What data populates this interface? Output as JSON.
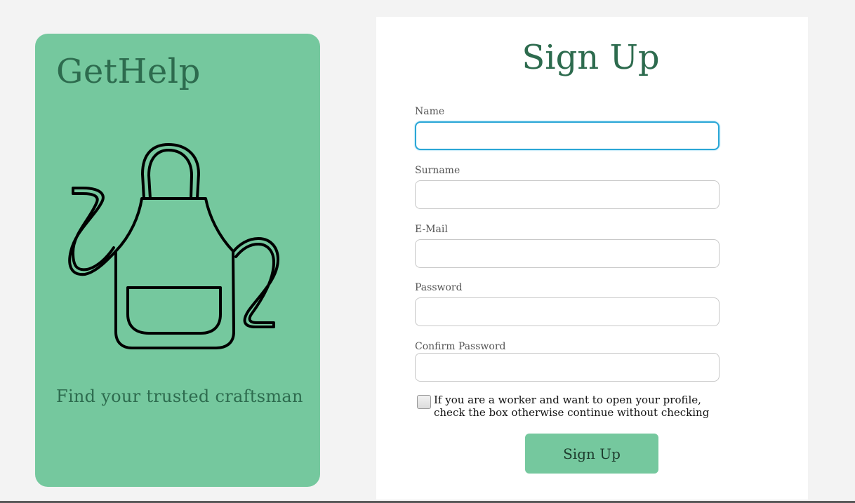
{
  "brand": {
    "title": "GetHelp",
    "tagline": "Find your trusted craftsman",
    "illustration_icon": "apron-icon",
    "card_color": "#75c89e",
    "text_color": "#2d6b4e"
  },
  "form": {
    "title": "Sign Up",
    "fields": [
      {
        "label": "Name",
        "value": ""
      },
      {
        "label": "Surname",
        "value": ""
      },
      {
        "label": "E-Mail",
        "value": ""
      },
      {
        "label": "Password",
        "value": ""
      },
      {
        "label": "Confirm Password",
        "value": ""
      }
    ],
    "worker_checkbox": {
      "label": "If you are a worker and want to open your profile, check the box otherwise continue without checking",
      "checked": false
    },
    "submit_label": "Sign Up",
    "accent_color": "#75c89e",
    "focus_color": "#2aa6d6"
  }
}
